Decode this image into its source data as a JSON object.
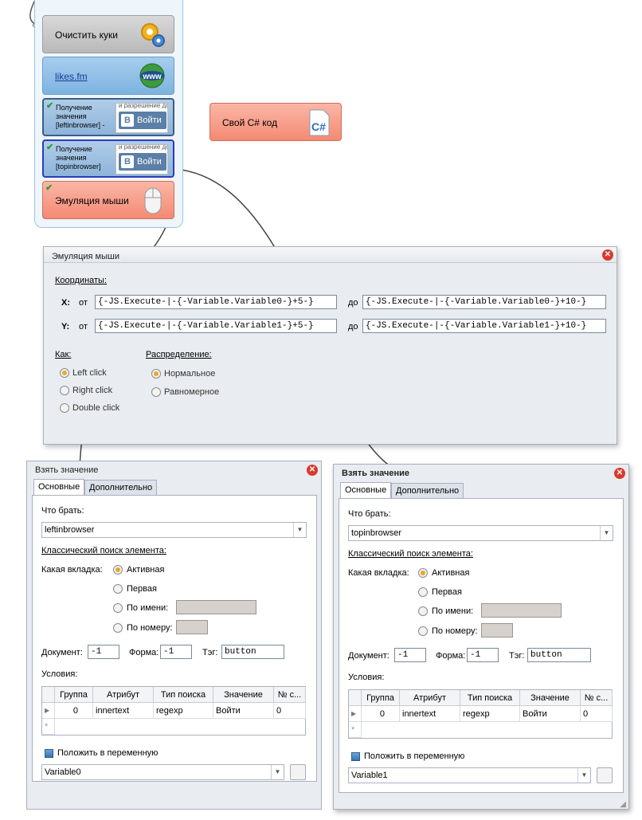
{
  "flow": {
    "blocks": [
      {
        "label": "Очистить куки",
        "icon": "gears-icon"
      },
      {
        "label": "likes.fm",
        "icon": "www-globe-icon"
      },
      {
        "label": "Получение значения [leftinbrowser] -",
        "thumb": "Войти",
        "thumb_top": "и разрешение дост"
      },
      {
        "label": "Получение значения [topinbrowser]",
        "thumb": "Войти",
        "thumb_top": "и разрешение дост"
      },
      {
        "label": "Эмуляция мыши",
        "icon": "mouse-icon"
      }
    ],
    "csharp": {
      "label": "Свой C# код",
      "icon": "csharp-file-icon"
    }
  },
  "mouse_dialog": {
    "title": "Эмуляция мыши",
    "coords_label": "Координаты:",
    "x_label": "X:",
    "y_label": "Y:",
    "from": "от",
    "to": "до",
    "x_from": "{-JS.Execute-|-{-Variable.Variable0-}+5-}",
    "x_to": "{-JS.Execute-|-{-Variable.Variable0-}+10-}",
    "y_from": "{-JS.Execute-|-{-Variable.Variable1-}+5-}",
    "y_to": "{-JS.Execute-|-{-Variable.Variable1-}+10-}",
    "how_label": "Как:",
    "how": [
      "Left click",
      "Right click",
      "Double click"
    ],
    "dist_label": "Распределение:",
    "dist": [
      "Нормальное",
      "Равномерное"
    ]
  },
  "left_dialog": {
    "title": "Взять значение",
    "tabs": [
      "Основные",
      "Дополнительно"
    ],
    "what_label": "Что брать:",
    "what_value": "leftinbrowser",
    "classic": "Классический поиск элемента:",
    "tab_label": "Какая вкладка:",
    "tab_opts": [
      "Активная",
      "Первая",
      "По имени:",
      "По номеру:"
    ],
    "doc_label": "Документ:",
    "doc": "-1",
    "form_label": "Форма:",
    "form": "-1",
    "tag_label": "Тэг:",
    "tag": "button",
    "cond_label": "Условия:",
    "cols": [
      "Группа",
      "Атрибут",
      "Тип поиска",
      "Значение",
      "№ с..."
    ],
    "row": [
      "0",
      "innertext",
      "regexp",
      "Войти",
      "0"
    ],
    "put_var": "Положить в переменную",
    "variable": "Variable0"
  },
  "right_dialog": {
    "title": "Взять значение",
    "tabs": [
      "Основные",
      "Дополнительно"
    ],
    "what_label": "Что брать:",
    "what_value": "topinbrowser",
    "classic": "Классический поиск элемента:",
    "tab_label": "Какая вкладка:",
    "tab_opts": [
      "Активная",
      "Первая",
      "По имени:",
      "По номеру:"
    ],
    "doc_label": "Документ:",
    "doc": "-1",
    "form_label": "Форма:",
    "form": "-1",
    "tag_label": "Тэг:",
    "tag": "button",
    "cond_label": "Условия:",
    "cols": [
      "Группа",
      "Атрибут",
      "Тип поиска",
      "Значение",
      "№ с..."
    ],
    "row": [
      "0",
      "innertext",
      "regexp",
      "Войти",
      "0"
    ],
    "put_var": "Положить в переменную",
    "variable": "Variable1"
  }
}
